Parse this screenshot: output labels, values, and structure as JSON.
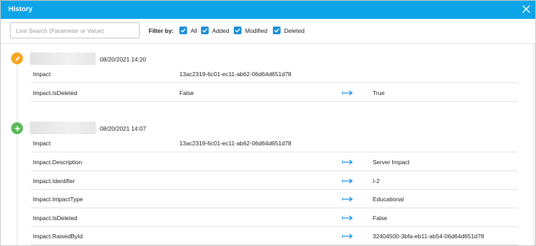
{
  "window": {
    "title": "History",
    "close_icon": "close-icon"
  },
  "toolbar": {
    "search": {
      "placeholder": "Live Search (Parameter or Value)",
      "value": ""
    },
    "filter_label": "Filter by:",
    "filters": [
      {
        "label": "All",
        "checked": true
      },
      {
        "label": "Added",
        "checked": true
      },
      {
        "label": "Modified",
        "checked": true
      },
      {
        "label": "Deleted",
        "checked": true
      }
    ]
  },
  "colors": {
    "titlebar": "#0ea4e8",
    "checkbox": "#1a8fd8",
    "modified_icon": "#f5a623",
    "added_icon": "#5cb85c",
    "arrow": "#1a8fd8"
  },
  "entries": [
    {
      "icon": "pencil-icon",
      "timestamp": "08/20/2021 14:20",
      "rows": [
        {
          "name": "Impact",
          "old": "13ac2319-6c01-ec11-ab62-06d64d651d78",
          "new": ""
        },
        {
          "name": "Impact.IsDeleted",
          "old": "False",
          "new": "True"
        }
      ]
    },
    {
      "icon": "plus-icon",
      "timestamp": "08/20/2021 14:07",
      "rows": [
        {
          "name": "Impact",
          "old": "13ac2319-6c01-ec11-ab62-06d64d651d78",
          "new": ""
        },
        {
          "name": "Impact.Description",
          "old": "",
          "new": "Server Impact"
        },
        {
          "name": "Impact.Identifier",
          "old": "",
          "new": "I-2"
        },
        {
          "name": "Impact.ImpactType",
          "old": "",
          "new": "Educational"
        },
        {
          "name": "Impact.IsDeleted",
          "old": "",
          "new": "False"
        },
        {
          "name": "Impact.RaisedById",
          "old": "",
          "new": "32404500-3bfa-eb11-ab54-06d64d651d78"
        }
      ]
    }
  ]
}
